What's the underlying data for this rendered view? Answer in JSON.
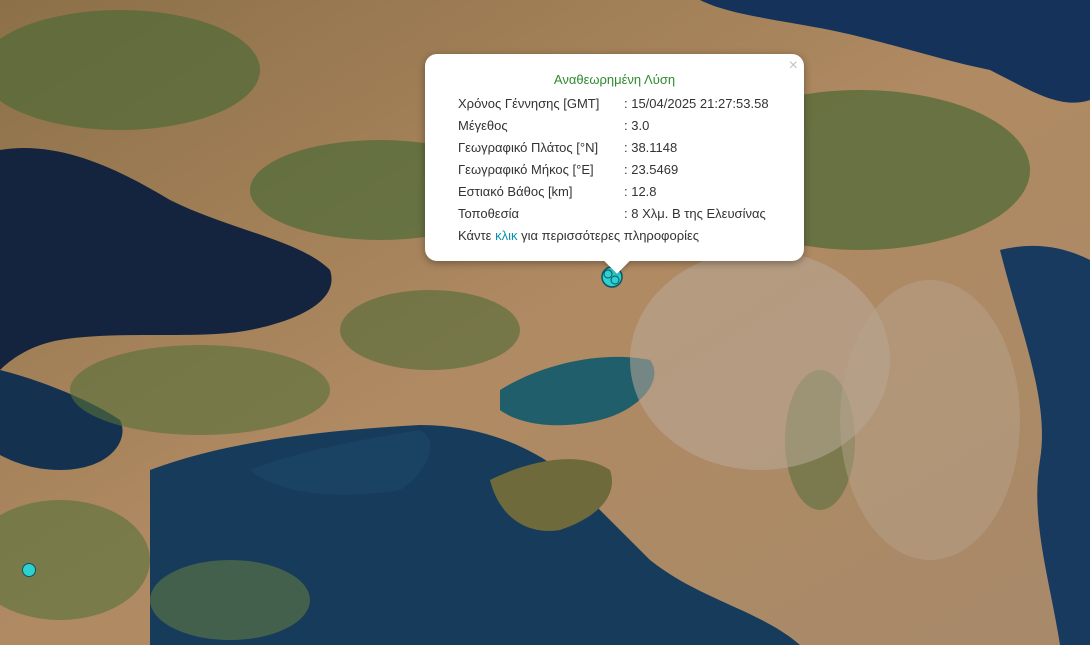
{
  "popup": {
    "title": "Αναθεωρημένη Λύση",
    "close_glyph": "×",
    "rows": [
      {
        "label": "Χρόνος Γέννησης [GMT]",
        "value": ": 15/04/2025 21:27:53.58"
      },
      {
        "label": "Μέγεθος",
        "value": ": 3.0"
      },
      {
        "label": "Γεωγραφικό Πλάτος [°N]",
        "value": ": 38.1148"
      },
      {
        "label": "Γεωγραφικό Μήκος [°E]",
        "value": ": 23.5469"
      },
      {
        "label": "Εστιακό Βάθος [km]",
        "value": ": 12.8"
      },
      {
        "label": "Τοποθεσία",
        "value": ": 8 Χλμ. Β της Ελευσίνας"
      }
    ],
    "more_prefix": "Κάντε ",
    "more_link": "κλικ",
    "more_suffix": " για περισσότερες πληροφορίες"
  },
  "colors": {
    "title_green": "#2e8b2e",
    "link_blue": "#0a8fb0",
    "marker_cyan": "#2fd0d0",
    "sea": "#123a5c",
    "land": "#a98560"
  }
}
